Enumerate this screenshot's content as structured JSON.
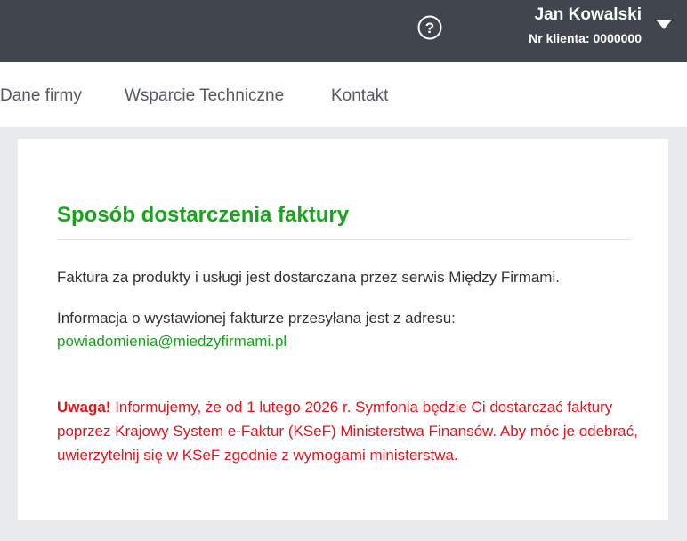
{
  "header": {
    "user_name": "Jan Kowalski",
    "client_number": "Nr klienta: 0000000",
    "help_icon": "question-circle-icon",
    "menu_icon": "caret-down-icon"
  },
  "nav": {
    "items": [
      {
        "label": "Dane firmy"
      },
      {
        "label": "Wsparcie Techniczne"
      },
      {
        "label": "Kontakt"
      }
    ]
  },
  "card": {
    "title": "Sposób dostarczenia faktury",
    "paragraph1": "Faktura za produkty i usługi jest dostarczana przez serwis Między Firmami.",
    "paragraph2": "Informacja o wystawionej fakturze przesyłana jest z adresu:",
    "email": "powiadomienia@miedzyfirmami.pl",
    "warning_label": "Uwaga!",
    "warning_text": "Informujemy, że od 1 lutego 2026 r. Symfonia będzie Ci dostarczać faktury poprzez Krajowy System e-Faktur (KSeF) Ministerstwa Finansów. Aby móc je odebrać, uwierzytelnij się w KSeF zgodnie z wymogami ministerstwa."
  },
  "colors": {
    "header_bg": "#41454d",
    "accent_green": "#17a51c",
    "warning_red": "#e3141b",
    "page_bg": "#e9eaec"
  }
}
